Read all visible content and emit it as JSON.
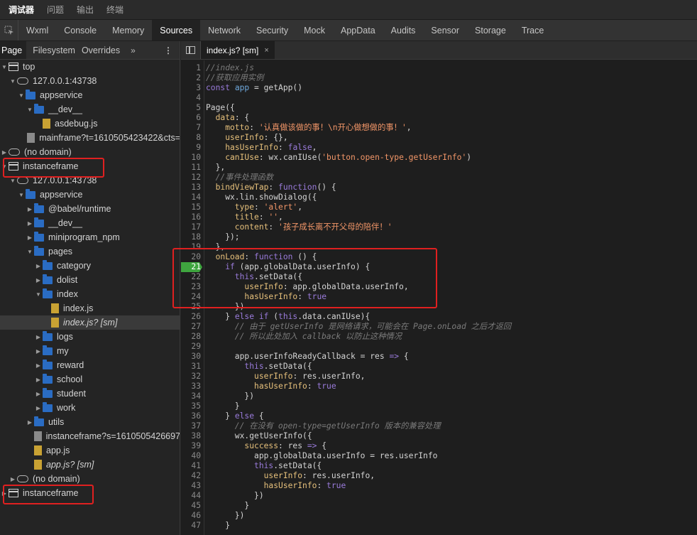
{
  "top_tabs": [
    "调试器",
    "问题",
    "输出",
    "终端"
  ],
  "panel_tabs": [
    "Wxml",
    "Console",
    "Memory",
    "Sources",
    "Network",
    "Security",
    "Mock",
    "AppData",
    "Audits",
    "Sensor",
    "Storage",
    "Trace"
  ],
  "sidebar": {
    "tabs": [
      "Page",
      "Filesystem",
      "Overrides"
    ],
    "more": "»",
    "menu": "⋮"
  },
  "tree": [
    {
      "label": "top",
      "arrow": "▼",
      "icon": "frame"
    },
    {
      "label": "127.0.0.1:43738",
      "arrow": "▼",
      "icon": "cloud"
    },
    {
      "label": "appservice",
      "arrow": "▼",
      "icon": "folder"
    },
    {
      "label": "__dev__",
      "arrow": "▼",
      "icon": "folder"
    },
    {
      "label": "asdebug.js",
      "arrow": "",
      "icon": "file"
    },
    {
      "label": "mainframe?t=1610505423422&cts=",
      "arrow": "",
      "icon": "file grey"
    },
    {
      "label": "(no domain)",
      "arrow": "▶",
      "icon": "cloud"
    },
    {
      "label": "instanceframe",
      "arrow": "▼",
      "icon": "frame"
    },
    {
      "label": "127.0.0.1:43738",
      "arrow": "▼",
      "icon": "cloud"
    },
    {
      "label": "appservice",
      "arrow": "▼",
      "icon": "folder"
    },
    {
      "label": "@babel/runtime",
      "arrow": "▶",
      "icon": "folder"
    },
    {
      "label": "__dev__",
      "arrow": "▶",
      "icon": "folder"
    },
    {
      "label": "miniprogram_npm",
      "arrow": "▶",
      "icon": "folder"
    },
    {
      "label": "pages",
      "arrow": "▼",
      "icon": "folder"
    },
    {
      "label": "category",
      "arrow": "▶",
      "icon": "folder"
    },
    {
      "label": "dolist",
      "arrow": "▶",
      "icon": "folder"
    },
    {
      "label": "index",
      "arrow": "▼",
      "icon": "folder"
    },
    {
      "label": "index.js",
      "arrow": "",
      "icon": "file"
    },
    {
      "label": "index.js? [sm]",
      "arrow": "",
      "icon": "file",
      "italic": true,
      "selected": true
    },
    {
      "label": "logs",
      "arrow": "▶",
      "icon": "folder"
    },
    {
      "label": "my",
      "arrow": "▶",
      "icon": "folder"
    },
    {
      "label": "reward",
      "arrow": "▶",
      "icon": "folder"
    },
    {
      "label": "school",
      "arrow": "▶",
      "icon": "folder"
    },
    {
      "label": "student",
      "arrow": "▶",
      "icon": "folder"
    },
    {
      "label": "work",
      "arrow": "▶",
      "icon": "folder"
    },
    {
      "label": "utils",
      "arrow": "▶",
      "icon": "folder"
    },
    {
      "label": "instanceframe?s=1610505426697",
      "arrow": "",
      "icon": "file grey"
    },
    {
      "label": "app.js",
      "arrow": "",
      "icon": "file"
    },
    {
      "label": "app.js? [sm]",
      "arrow": "",
      "icon": "file",
      "italic": true
    },
    {
      "label": "(no domain)",
      "arrow": "▶",
      "icon": "cloud"
    },
    {
      "label": "instanceframe",
      "arrow": "▶",
      "icon": "frame"
    }
  ],
  "editor": {
    "tab_label": "index.js? [sm]",
    "close": "×",
    "breakpoint_line": 21,
    "lines": [
      [
        [
          "cm",
          "//index.js"
        ]
      ],
      [
        [
          "cm",
          "//获取应用实例"
        ]
      ],
      [
        [
          "kw",
          "const "
        ],
        [
          "var",
          "app"
        ],
        [
          "fn",
          " = getApp()"
        ]
      ],
      [],
      [
        [
          "fn",
          "Page({"
        ]
      ],
      [
        [
          "prop",
          "  data"
        ],
        [
          "fn",
          ": {"
        ]
      ],
      [
        [
          "prop",
          "    motto"
        ],
        [
          "fn",
          ": "
        ],
        [
          "str",
          "'认真做该做的事！\\n开心做想做的事！'"
        ],
        [
          "fn",
          ","
        ]
      ],
      [
        [
          "prop",
          "    userInfo"
        ],
        [
          "fn",
          ": {},"
        ]
      ],
      [
        [
          "prop",
          "    hasUserInfo"
        ],
        [
          "fn",
          ": "
        ],
        [
          "kw",
          "false"
        ],
        [
          "fn",
          ","
        ]
      ],
      [
        [
          "prop",
          "    canIUse"
        ],
        [
          "fn",
          ": wx.canIUse("
        ],
        [
          "str",
          "'button.open-type.getUserInfo'"
        ],
        [
          "fn",
          ")"
        ]
      ],
      [
        [
          "fn",
          "  },"
        ]
      ],
      [
        [
          "cm",
          "  //事件处理函数"
        ]
      ],
      [
        [
          "prop",
          "  bindViewTap"
        ],
        [
          "fn",
          ": "
        ],
        [
          "kw",
          "function"
        ],
        [
          "fn",
          "() {"
        ]
      ],
      [
        [
          "fn",
          "    wx.lin.showDialog({"
        ]
      ],
      [
        [
          "prop",
          "      type"
        ],
        [
          "fn",
          ": "
        ],
        [
          "str",
          "'alert'"
        ],
        [
          "fn",
          ","
        ]
      ],
      [
        [
          "prop",
          "      title"
        ],
        [
          "fn",
          ": "
        ],
        [
          "str",
          "''"
        ],
        [
          "fn",
          ","
        ]
      ],
      [
        [
          "prop",
          "      content"
        ],
        [
          "fn",
          ": "
        ],
        [
          "str",
          "'孩子成长离不开父母的陪伴！'"
        ]
      ],
      [
        [
          "fn",
          "    });"
        ]
      ],
      [
        [
          "fn",
          "  },"
        ]
      ],
      [
        [
          "prop",
          "  onLoad"
        ],
        [
          "fn",
          ": "
        ],
        [
          "kw",
          "function"
        ],
        [
          "fn",
          " () {"
        ]
      ],
      [
        [
          "kw",
          "    if"
        ],
        [
          "fn",
          " (app.globalData.userInfo) {"
        ]
      ],
      [
        [
          "kw",
          "      this"
        ],
        [
          "fn",
          ".setData({"
        ]
      ],
      [
        [
          "prop",
          "        userInfo"
        ],
        [
          "fn",
          ": app.globalData.userInfo,"
        ]
      ],
      [
        [
          "prop",
          "        hasUserInfo"
        ],
        [
          "fn",
          ": "
        ],
        [
          "kw",
          "true"
        ]
      ],
      [
        [
          "fn",
          "      })"
        ]
      ],
      [
        [
          "fn",
          "    } "
        ],
        [
          "kw",
          "else if"
        ],
        [
          "fn",
          " ("
        ],
        [
          "kw",
          "this"
        ],
        [
          "fn",
          ".data.canIUse){"
        ]
      ],
      [
        [
          "cm",
          "      // 由于 getUserInfo 是网络请求，可能会在 Page.onLoad 之后才返回"
        ]
      ],
      [
        [
          "cm",
          "      // 所以此处加入 callback 以防止这种情况"
        ]
      ],
      [],
      [
        [
          "fn",
          "      app.userInfoReadyCallback = res "
        ],
        [
          "kw",
          "=>"
        ],
        [
          "fn",
          " {"
        ]
      ],
      [
        [
          "kw",
          "        this"
        ],
        [
          "fn",
          ".setData({"
        ]
      ],
      [
        [
          "prop",
          "          userInfo"
        ],
        [
          "fn",
          ": res.userInfo,"
        ]
      ],
      [
        [
          "prop",
          "          hasUserInfo"
        ],
        [
          "fn",
          ": "
        ],
        [
          "kw",
          "true"
        ]
      ],
      [
        [
          "fn",
          "        })"
        ]
      ],
      [
        [
          "fn",
          "      }"
        ]
      ],
      [
        [
          "fn",
          "    } "
        ],
        [
          "kw",
          "else"
        ],
        [
          "fn",
          " {"
        ]
      ],
      [
        [
          "cm",
          "      // 在没有 open-type=getUserInfo 版本的兼容处理"
        ]
      ],
      [
        [
          "fn",
          "      wx.getUserInfo({"
        ]
      ],
      [
        [
          "prop",
          "        success"
        ],
        [
          "fn",
          ": res "
        ],
        [
          "kw",
          "=>"
        ],
        [
          "fn",
          " {"
        ]
      ],
      [
        [
          "fn",
          "          app.globalData.userInfo = res.userInfo"
        ]
      ],
      [
        [
          "kw",
          "          this"
        ],
        [
          "fn",
          ".setData({"
        ]
      ],
      [
        [
          "prop",
          "            userInfo"
        ],
        [
          "fn",
          ": res.userInfo,"
        ]
      ],
      [
        [
          "prop",
          "            hasUserInfo"
        ],
        [
          "fn",
          ": "
        ],
        [
          "kw",
          "true"
        ]
      ],
      [
        [
          "fn",
          "          })"
        ]
      ],
      [
        [
          "fn",
          "        }"
        ]
      ],
      [
        [
          "fn",
          "      })"
        ]
      ],
      [
        [
          "fn",
          "    }"
        ]
      ]
    ]
  }
}
